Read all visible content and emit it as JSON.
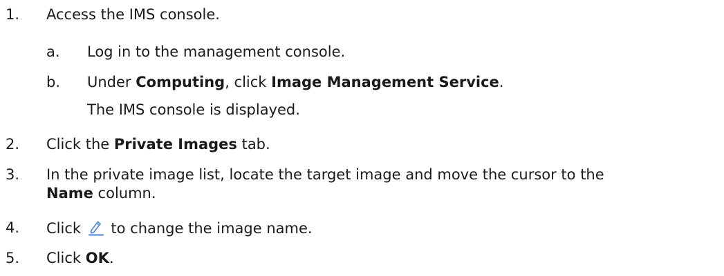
{
  "steps": [
    {
      "number": "1.",
      "text": "Access the IMS console.",
      "substeps": [
        {
          "letter": "a.",
          "text": "Log in to the management console."
        },
        {
          "letter": "b.",
          "pre": "Under ",
          "bold1": "Computing",
          "mid": ", click ",
          "bold2": "Image Management Service",
          "post": ".",
          "result": "The IMS console is displayed."
        }
      ]
    },
    {
      "number": "2.",
      "pre": "Click the ",
      "bold": "Private Images",
      "post": " tab."
    },
    {
      "number": "3.",
      "line1": "In the private image list, locate the target image and move the cursor to the",
      "bold": "Name",
      "post": " column."
    },
    {
      "number": "4.",
      "pre": "Click ",
      "icon": "edit-pencil-icon",
      "post": " to change the image name."
    },
    {
      "number": "5.",
      "pre": "Click ",
      "bold": "OK",
      "post": "."
    }
  ],
  "colors": {
    "text": "#1a1a1a",
    "icon": "#5b8fd6"
  }
}
